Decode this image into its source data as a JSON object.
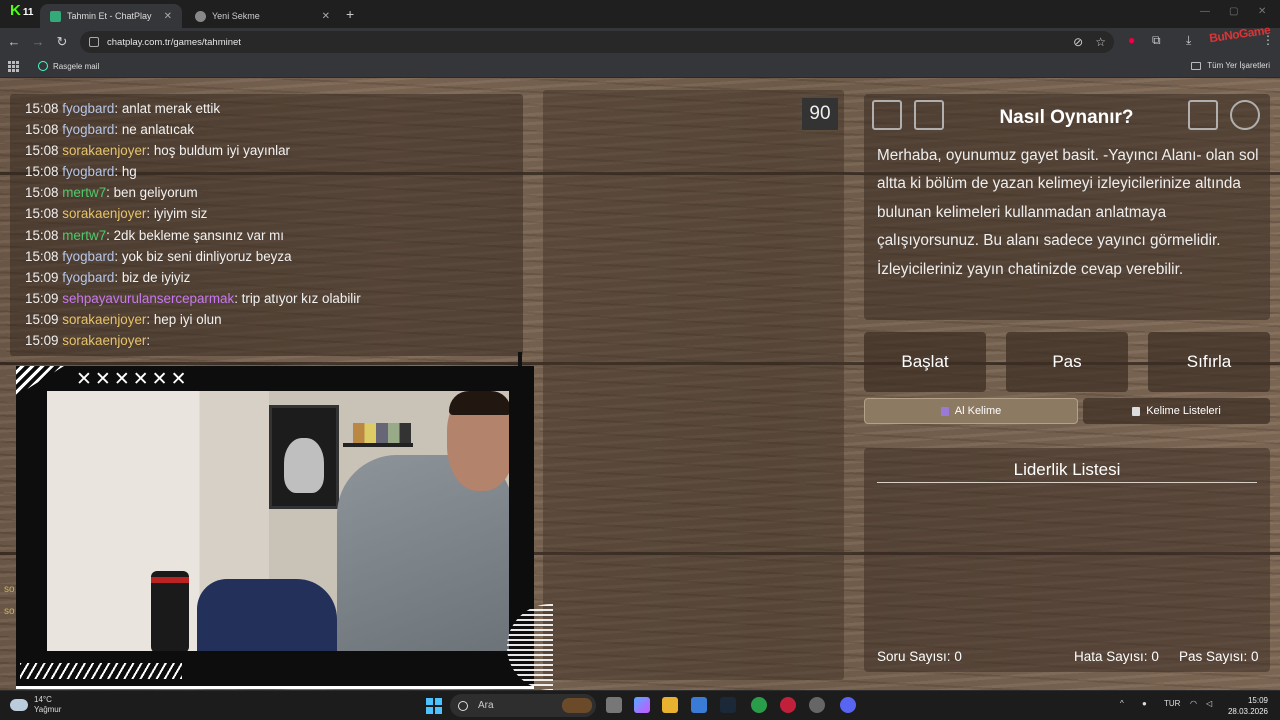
{
  "browser": {
    "kick_badge": "11",
    "tabs": [
      {
        "title": "Tahmin Et - ChatPlay",
        "active": true
      },
      {
        "title": "Yeni Sekme",
        "active": false
      }
    ],
    "url": "chatplay.com.tr/games/tahminet",
    "overlay_brand": "BuNoGame",
    "bookmarks": {
      "item": "Rasgele mail",
      "all": "Tüm Yer İşaretleri"
    }
  },
  "chat": {
    "messages": [
      {
        "time": "15:08",
        "user": "fyogbard",
        "text": ": anlat merak ettik",
        "color": "#b6c6e8"
      },
      {
        "time": "15:08",
        "user": "fyogbard",
        "text": ": ne anlatıcak",
        "color": "#b6c6e8"
      },
      {
        "time": "15:08",
        "user": "sorakaenjoyer",
        "text": ": hoş buldum iyi yayınlar",
        "color": "#e6c36a"
      },
      {
        "time": "15:08",
        "user": "fyogbard",
        "text": ": hg",
        "color": "#b6c6e8"
      },
      {
        "time": "15:08",
        "user": "mertw7",
        "text": ": ben geliyorum",
        "color": "#4ec96a"
      },
      {
        "time": "15:08",
        "user": "sorakaenjoyer",
        "text": ": iyiyim siz",
        "color": "#e6c36a"
      },
      {
        "time": "15:08",
        "user": "mertw7",
        "text": ": 2dk bekleme şansınız var mı",
        "color": "#4ec96a"
      },
      {
        "time": "15:08",
        "user": "fyogbard",
        "text": ": yok biz seni dinliyoruz beyza",
        "color": "#b6c6e8"
      },
      {
        "time": "15:09",
        "user": "fyogbard",
        "text": ": biz de iyiyiz",
        "color": "#b6c6e8"
      },
      {
        "time": "15:09",
        "user": "sehpayavurulanserceparmak",
        "text": ": trip atıyor kız olabilir",
        "color": "#c878f0"
      },
      {
        "time": "15:09",
        "user": "sorakaenjoyer",
        "text": ": hep iyi olun",
        "color": "#e6c36a"
      },
      {
        "time": "15:09",
        "user": "sorakaenjoyer",
        "text": ":",
        "color": "#e6c36a"
      }
    ],
    "edge_fragments": [
      "so",
      "so"
    ]
  },
  "webcam": {
    "marks": "✕✕✕✕✕✕"
  },
  "timer": "90",
  "howto": {
    "title": "Nasıl Oynanır?",
    "description": "Merhaba, oyunumuz gayet basit. -Yayıncı Alanı- olan sol altta ki bölüm de yazan kelimeyi izleyicilerinize altında bulunan kelimeleri kullanmadan anlatmaya çalışıyorsunuz. Bu alanı sadece yayıncı görmelidir. İzleyicileriniz yayın chatinizde cevap verebilir."
  },
  "controls": {
    "start": "Başlat",
    "pass": "Pas",
    "reset": "Sıfırla",
    "get_word": "Al Kelime",
    "word_lists": "Kelime Listeleri"
  },
  "leaderboard": {
    "title": "Liderlik Listesi",
    "stats": [
      {
        "label": "Soru Sayısı:",
        "value": "0"
      },
      {
        "label": "Hata Sayısı:",
        "value": "0"
      },
      {
        "label": "Pas Sayısı:",
        "value": "0"
      }
    ]
  },
  "taskbar": {
    "temperature": "14°C",
    "condition": "Yağmur",
    "search_placeholder": "Ara",
    "language": "TUR",
    "time": "15:09",
    "date": "28.03.2026"
  },
  "colors": {
    "accent_get_word": "#8c7a62",
    "kick_green": "#53fc18"
  }
}
